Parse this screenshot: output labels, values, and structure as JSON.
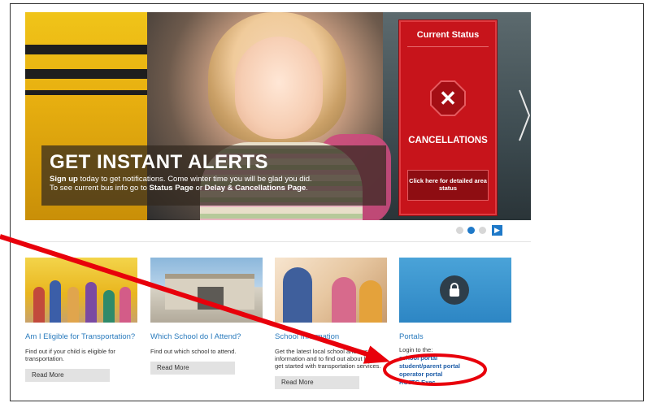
{
  "hero": {
    "alert_title": "GET INSTANT ALERTS",
    "alert_line1_strong": "Sign up",
    "alert_line1_rest": " today to get notifications.  Come winter time you will be glad you did.",
    "alert_line2_prefix": "To see current bus info go to ",
    "alert_line2_link1": "Status Page",
    "alert_line2_mid": " or ",
    "alert_line2_link2": "Delay & Cancellations Page",
    "alert_line2_end": ".",
    "next_icon": "chevron-right-icon"
  },
  "status_panel": {
    "title": "Current Status",
    "icon": "close-octagon-icon",
    "icon_glyph": "✕",
    "label": "CANCELLATIONS",
    "button_label": "Click here for detailed area status"
  },
  "carousel": {
    "dots": 3,
    "active_dot": 2,
    "next_glyph": "▶"
  },
  "cards": [
    {
      "title": "Am I Eligible for Transportation?",
      "description": "Find out if your child is eligible for transportation.",
      "button": "Read More"
    },
    {
      "title": "Which School do I Attend?",
      "description": "Find out which school to attend.",
      "button": "Read More"
    },
    {
      "title": "School Information",
      "description": "Get the latest local school and bus information and to find out about how to get started with transportation services.",
      "button": "Read More"
    },
    {
      "title": "Portals",
      "description": "Login to the:",
      "links": [
        "school portal",
        "student/parent portal",
        "operator portal",
        "RCJTC Exec"
      ]
    }
  ],
  "annotation": {
    "color": "#e8000b"
  }
}
